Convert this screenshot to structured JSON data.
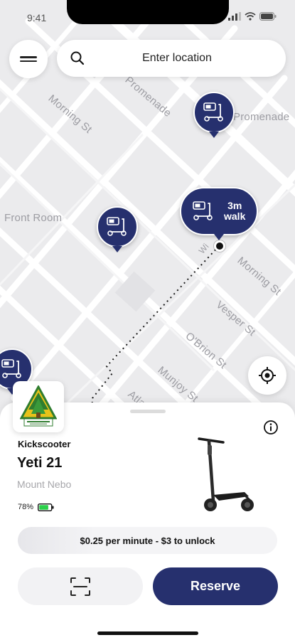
{
  "status": {
    "time": "9:41"
  },
  "search": {
    "placeholder": "Enter location"
  },
  "map": {
    "streets": [
      "Morning St",
      "Promenade",
      "Promenade",
      "Front Room",
      "Morning St",
      "Vesper St",
      "O'Brion St",
      "Munjoy St",
      "Atla",
      "Wi"
    ],
    "nearest_pin": {
      "walk_time": "3m",
      "walk_label": "walk"
    }
  },
  "vehicle": {
    "type": "Kickscooter",
    "name": "Yeti 21",
    "location": "Mount Nebo",
    "battery_percent": "78%",
    "battery_level": 0.78,
    "price_text": "$0.25 per minute - $3 to unlock"
  },
  "actions": {
    "reserve_label": "Reserve"
  },
  "colors": {
    "brand": "#26306e",
    "battery": "#2bd14a",
    "map_bg": "#ebebed"
  },
  "icons": [
    "menu-icon",
    "search-icon",
    "scooter-icon",
    "locate-icon",
    "info-icon",
    "scan-icon",
    "battery-icon"
  ]
}
